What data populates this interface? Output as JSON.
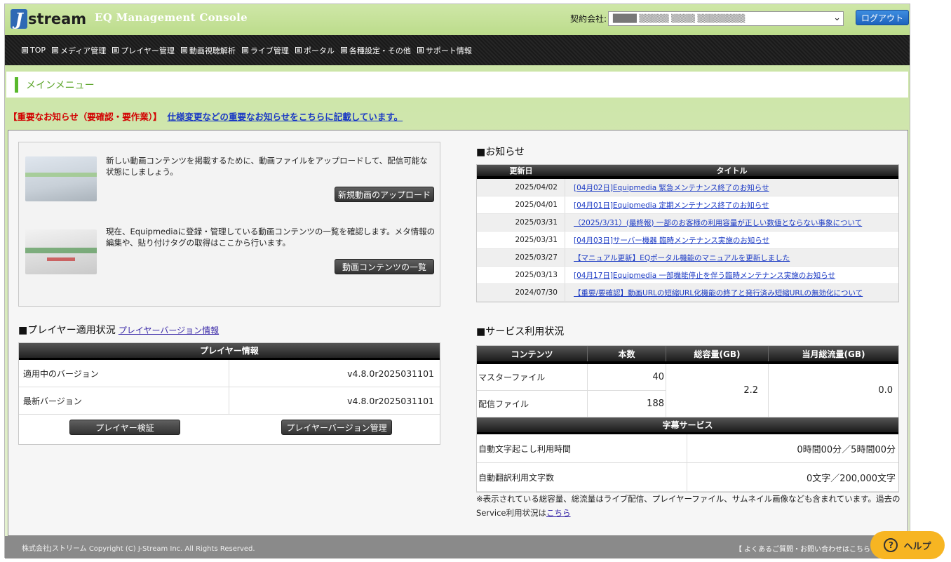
{
  "header": {
    "logo_letter": "J",
    "logo_text": "stream",
    "console_title": "EQ Management Console",
    "contract_label": "契約会社:",
    "contract_value": "████  ▒▒▒▒▒ ▒▒▒▒ ▒▒▒▒▒▒▒▒",
    "logout_label": "ログアウト"
  },
  "nav": {
    "items": [
      {
        "label": "TOP"
      },
      {
        "label": "メディア管理"
      },
      {
        "label": "プレイヤー管理"
      },
      {
        "label": "動画視聴解析"
      },
      {
        "label": "ライブ管理"
      },
      {
        "label": "ポータル"
      },
      {
        "label": "各種設定・その他"
      },
      {
        "label": "サポート情報"
      }
    ]
  },
  "menubar": {
    "title": "メインメニュー"
  },
  "notice": {
    "label": "【重要なお知らせ（要確認・要作業）】",
    "link": "仕様変更などの重要なお知らせをこちらに記載しています。"
  },
  "upload": {
    "new_desc": "新しい動画コンテンツを掲載するために、動画ファイルをアップロードして、配信可能な状態にしましょう。",
    "new_button": "新規動画のアップロード",
    "list_desc": "現在、Equipmediaに登録・管理している動画コンテンツの一覧を確認します。メタ情報の編集や、貼り付けタグの取得はここから行います。",
    "list_button": "動画コンテンツの一覧"
  },
  "player": {
    "section_title": "■プレイヤー適用状況",
    "version_link": "プレイヤーバージョン情報",
    "table_head": "プレイヤー情報",
    "rows": [
      {
        "key": "適用中のバージョン",
        "value": "v4.8.0r2025031101"
      },
      {
        "key": "最新バージョン",
        "value": "v4.8.0r2025031101"
      }
    ],
    "verify_button": "プレイヤー検証",
    "manage_button": "プレイヤーバージョン管理"
  },
  "news": {
    "section_title": "■お知らせ",
    "col_date": "更新日",
    "col_title": "タイトル",
    "rows": [
      {
        "date": "2025/04/02",
        "title": "[04月02日]Equipmedia 緊急メンテナンス終了のお知らせ"
      },
      {
        "date": "2025/04/01",
        "title": "[04月01日]Equipmedia 定期メンテナンス終了のお知らせ"
      },
      {
        "date": "2025/03/31",
        "title": "（2025/3/31）(最終報) 一部のお客様の利用容量が正しい数値とならない事象について"
      },
      {
        "date": "2025/03/31",
        "title": "[04月03日]サーバー機器 臨時メンテナンス実施のお知らせ"
      },
      {
        "date": "2025/03/27",
        "title": "【マニュアル更新】EQポータル機能のマニュアルを更新しました"
      },
      {
        "date": "2025/03/13",
        "title": "[04月17日]Equipmedia 一部機能停止を伴う臨時メンテナンス実施のお知らせ"
      },
      {
        "date": "2024/07/30",
        "title": "【重要/要確認】動画URLの短縮URL化機能の終了と発行済み短縮URLの無効化について"
      }
    ]
  },
  "service": {
    "section_title": "■サービス利用状況",
    "cols": [
      "コンテンツ",
      "本数",
      "総容量(GB)",
      "当月総流量(GB)"
    ],
    "master_label": "マスターファイル",
    "master_count": "40",
    "delivery_label": "配信ファイル",
    "delivery_count": "188",
    "total_capacity": "2.2",
    "monthly_traffic": "0.0",
    "caption_head": "字幕サービス",
    "caption_rows": [
      {
        "key": "自動文字起こし利用時間",
        "value": "0時間00分／5時間00分"
      },
      {
        "key": "自動翻訳利用文字数",
        "value": "0文字／200,000文字"
      }
    ],
    "footnote": "※表示されている総容量、総流量はライブ配信、プレイヤーファイル、サムネイル画像なども含まれています。過去のService利用状況は",
    "footnote_link": "こちら"
  },
  "footer": {
    "copyright": "株式会社Jストリーム  Copyright (C) J-Stream Inc. All Rights Reserved.",
    "faq": "【 よくあるご質問・お問い合わせはこちら",
    "help_label": "ヘルプ"
  }
}
